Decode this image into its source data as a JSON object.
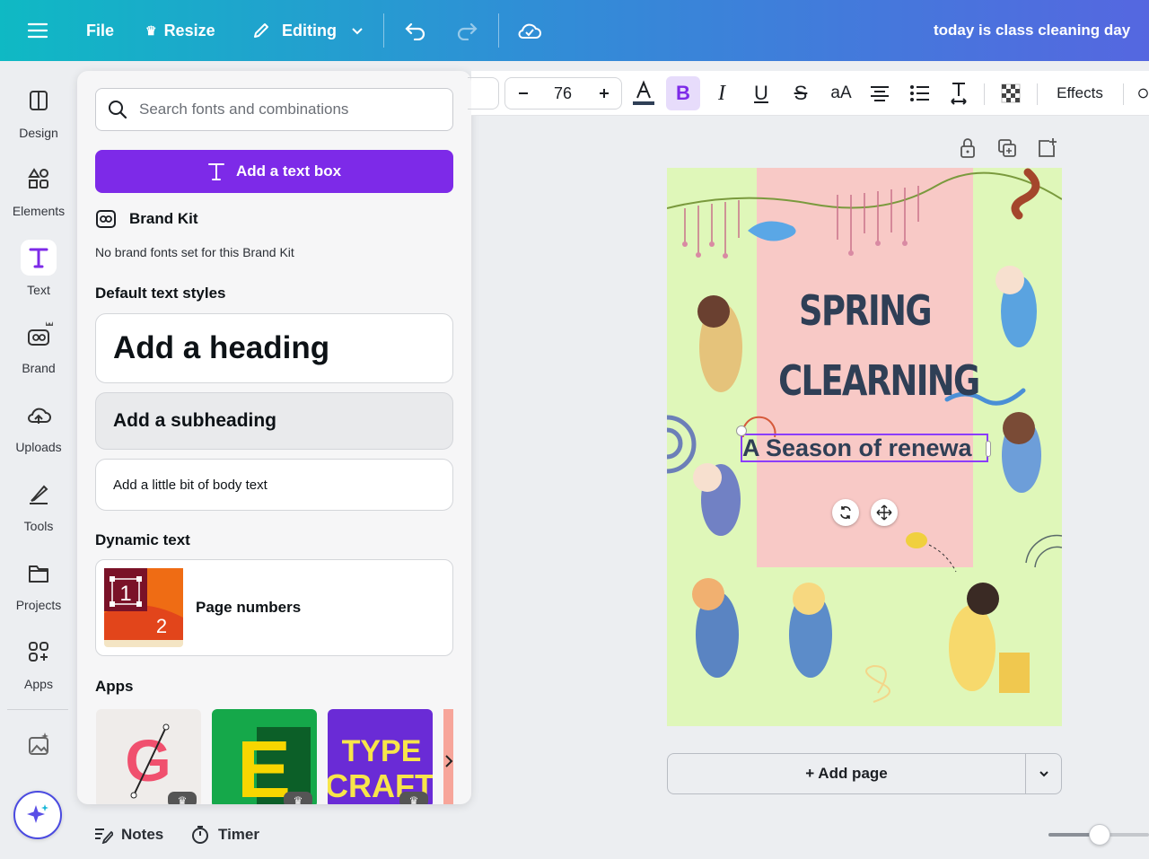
{
  "topbar": {
    "file": "File",
    "resize": "Resize",
    "editing": "Editing",
    "doc_title": "today is class cleaning day"
  },
  "rail": [
    {
      "label": "Design",
      "icon": "design-icon"
    },
    {
      "label": "Elements",
      "icon": "elements-icon"
    },
    {
      "label": "Text",
      "icon": "text-icon"
    },
    {
      "label": "Brand",
      "icon": "brand-icon"
    },
    {
      "label": "Uploads",
      "icon": "uploads-icon"
    },
    {
      "label": "Tools",
      "icon": "tools-icon"
    },
    {
      "label": "Projects",
      "icon": "projects-icon"
    },
    {
      "label": "Apps",
      "icon": "apps-icon"
    }
  ],
  "panel": {
    "search_placeholder": "Search fonts and combinations",
    "add_text_box": "Add a text box",
    "brand_kit": "Brand Kit",
    "no_brand_fonts": "No brand fonts set for this Brand Kit",
    "default_styles": "Default text styles",
    "heading": "Add a heading",
    "subheading": "Add a subheading",
    "body": "Add a little bit of body text",
    "dynamic_text": "Dynamic text",
    "page_numbers": "Page numbers",
    "apps": "Apps",
    "app_tiles": [
      "G",
      "E",
      "TYPE CRAFT"
    ]
  },
  "toolbar": {
    "font_size": "76",
    "effects": "Effects"
  },
  "design": {
    "title_line1": "SPRING",
    "title_line2": "CLEARNING",
    "subtitle": "A Season of renewa"
  },
  "add_page": "+ Add page",
  "footer": {
    "notes": "Notes",
    "timer": "Timer"
  },
  "colors": {
    "accent": "#7d2ae8",
    "canvas_bg": "#dff7b9",
    "canvas_panel": "#f8c9c6",
    "title_text": "#2f3f56"
  }
}
